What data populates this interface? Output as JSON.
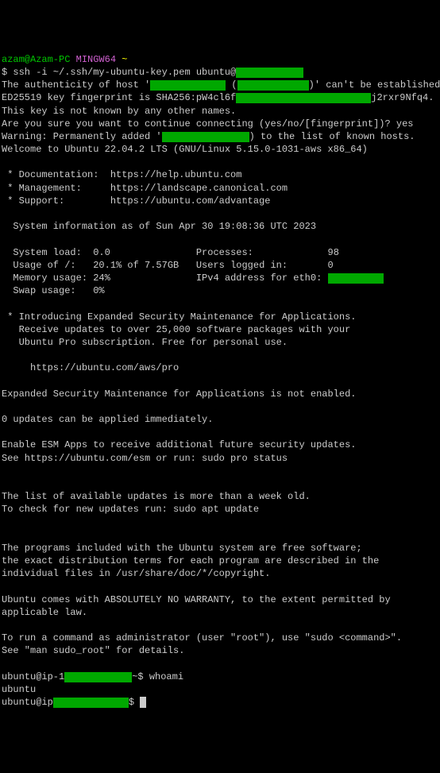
{
  "prompt1": {
    "user": "azam@Azam-PC",
    "shell": "MINGW64",
    "path": "~"
  },
  "cmd_ssh": "$ ssh -i ~/.ssh/my-ubuntu-key.pem ubuntu@",
  "auth1": "The authenticity of host '",
  "auth2": " (",
  "auth3": ")' can't be established.",
  "fp1": "ED25519 key fingerprint is SHA256:pW4cl6f",
  "fp2": "j2rxr9Nfq4.",
  "unknown": "This key is not known by any other names.",
  "confirm": "Are you sure you want to continue connecting (yes/no/[fingerprint])? yes",
  "warn1": "Warning: Permanently added '",
  "warn2": ") to the list of known hosts.",
  "welcome": "Welcome to Ubuntu 22.04.2 LTS (GNU/Linux 5.15.0-1031-aws x86_64)",
  "doc": " * Documentation:  https://help.ubuntu.com",
  "mgmt": " * Management:     https://landscape.canonical.com",
  "support": " * Support:        https://ubuntu.com/advantage",
  "sysinfo_header": "  System information as of Sun Apr 30 19:08:36 UTC 2023",
  "sys": {
    "load_label": "  System load:  ",
    "load_val": "0.0",
    "proc_label": "Processes:             ",
    "proc_val": "98",
    "usage_label": "  Usage of /:   ",
    "usage_val": "20.1% of 7.57GB",
    "users_label": "Users logged in:       ",
    "users_val": "0",
    "mem_label": "  Memory usage: ",
    "mem_val": "24%",
    "ipv4_label": "IPv4 address for eth0: ",
    "swap_label": "  Swap usage:   ",
    "swap_val": "0%"
  },
  "esm1": " * Introducing Expanded Security Maintenance for Applications.",
  "esm2": "   Receive updates to over 25,000 software packages with your",
  "esm3": "   Ubuntu Pro subscription. Free for personal use.",
  "esm_url": "     https://ubuntu.com/aws/pro",
  "esm_notenabled": "Expanded Security Maintenance for Applications is not enabled.",
  "updates0": "0 updates can be applied immediately.",
  "enable_esm": "Enable ESM Apps to receive additional future security updates.",
  "see_esm": "See https://ubuntu.com/esm or run: sudo pro status",
  "weekold": "The list of available updates is more than a week old.",
  "aptupdate": "To check for new updates run: sudo apt update",
  "free1": "The programs included with the Ubuntu system are free software;",
  "free2": "the exact distribution terms for each program are described in the",
  "free3": "individual files in /usr/share/doc/*/copyright.",
  "warranty1": "Ubuntu comes with ABSOLUTELY NO WARRANTY, to the extent permitted by",
  "warranty2": "applicable law.",
  "sudo1": "To run a command as administrator (user \"root\"), use \"sudo <command>\".",
  "sudo2": "See \"man sudo_root\" for details.",
  "p2_pre": "ubuntu@ip-1",
  "p2_post": "~$ whoami",
  "whoami_out": "ubuntu",
  "p3_pre": "ubuntu@ip",
  "p3_post": "$ "
}
